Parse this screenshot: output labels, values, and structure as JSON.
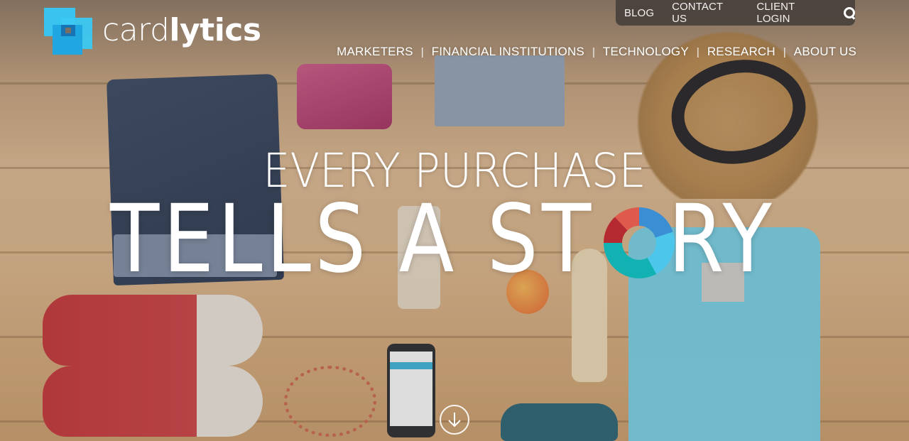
{
  "brand": {
    "logo_light": "card",
    "logo_bold": "lytics",
    "logo_icon": "overlapping-squares-logo-icon",
    "colors": {
      "logo_light_blue": "#38c4ef",
      "logo_mid_blue": "#20a6e0",
      "logo_dark_blue": "#1674b5"
    }
  },
  "utility_nav": {
    "items": [
      {
        "label": "BLOG"
      },
      {
        "label": "CONTACT US"
      },
      {
        "label": "CLIENT LOGIN"
      }
    ],
    "search_icon": "search-icon",
    "background": "#463e3a"
  },
  "main_nav": {
    "items": [
      {
        "label": "MARKETERS"
      },
      {
        "label": "FINANCIAL INSTITUTIONS"
      },
      {
        "label": "TECHNOLOGY"
      },
      {
        "label": "RESEARCH"
      },
      {
        "label": "ABOUT US"
      }
    ],
    "separator": "|"
  },
  "hero": {
    "line1": "EVERY PURCHASE",
    "line2_before": "TELLS A ST",
    "line2_after": "RY",
    "donut_replaces_letter": "O",
    "donut_segments": [
      {
        "color": "#3a8fd4",
        "share": 0.2
      },
      {
        "color": "#4cc6ea",
        "share": 0.22
      },
      {
        "color": "#12b2b3",
        "share": 0.33
      },
      {
        "color": "#b52a30",
        "share": 0.13
      },
      {
        "color": "#dd5a4c",
        "share": 0.12
      }
    ],
    "scroll_icon": "arrow-down-circle-icon"
  }
}
